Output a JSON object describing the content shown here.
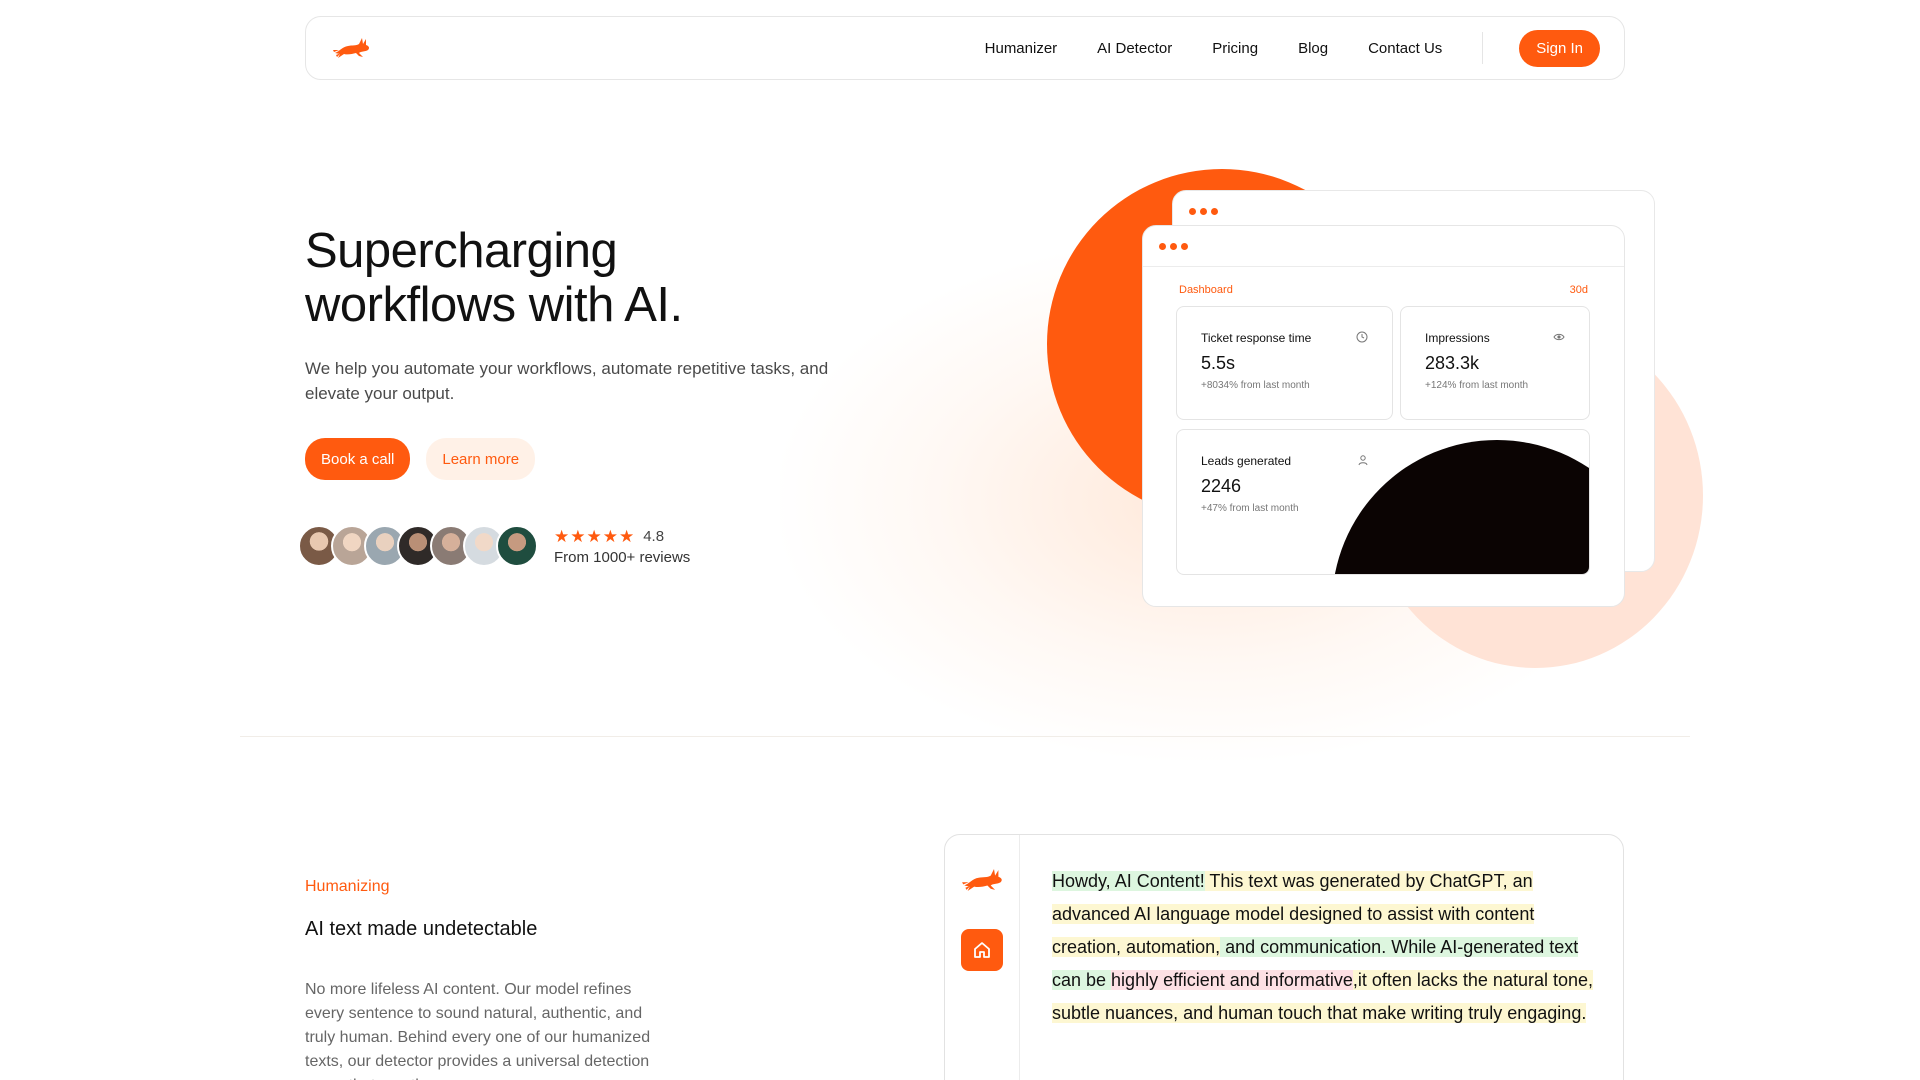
{
  "nav": {
    "links": [
      "Humanizer",
      "AI Detector",
      "Pricing",
      "Blog",
      "Contact Us"
    ],
    "signin_label": "Sign In",
    "logo_icon": "jumping-rabbit-logo"
  },
  "hero": {
    "title_line1": "Supercharging",
    "title_line2": "workflows with AI.",
    "subtitle": "We help you automate your workflows, automate repetitive tasks, and elevate your output.",
    "primary_cta": "Book a call",
    "secondary_cta": "Learn more",
    "rating": "4.8",
    "stars": "★★★★★",
    "reviews": "From 1000+ reviews",
    "avatar_colors": [
      "#b48a6e",
      "#c9a48a",
      "#a9b2b8",
      "#5a4236",
      "#8f7467",
      "#d8dde2",
      "#2f5a4b"
    ]
  },
  "dashboard": {
    "label": "Dashboard",
    "range": "30d",
    "metrics": [
      {
        "title": "Ticket response time",
        "value": "5.5s",
        "delta": "+8034% from last month",
        "icon": "clock-icon"
      },
      {
        "title": "Impressions",
        "value": "283.3k",
        "delta": "+124% from last month",
        "icon": "eye-icon"
      },
      {
        "title": "Leads generated",
        "value": "2246",
        "delta": "+47% from last month",
        "icon": "user-icon"
      }
    ]
  },
  "humanizing": {
    "eyebrow": "Humanizing",
    "title": "AI text made undetectable",
    "body": "No more lifeless AI content. Our model refines every sentence to sound natural, authentic, and truly human. Behind every one of our humanized texts, our detector provides a universal detection score that no other",
    "sample_segments": [
      {
        "text": "Howdy, AI Content!",
        "hl": "g"
      },
      {
        "text": " This text was generated by ChatGPT, an advanced AI language model designed to assist with content creation, automation,",
        "hl": "y"
      },
      {
        "text": " and communication.",
        "hl": "g"
      },
      {
        "text": " While AI-generated text can be ",
        "hl": "g"
      },
      {
        "text": "highly efficient and informative",
        "hl": "p"
      },
      {
        "text": ",it often lacks the natural tone, subtle nuances, and human touch that make writing truly engaging.",
        "hl": "y"
      }
    ]
  },
  "colors": {
    "accent": "#ff5a0f",
    "accent_soft": "#fff1e7",
    "peach": "#ffe3d6"
  }
}
